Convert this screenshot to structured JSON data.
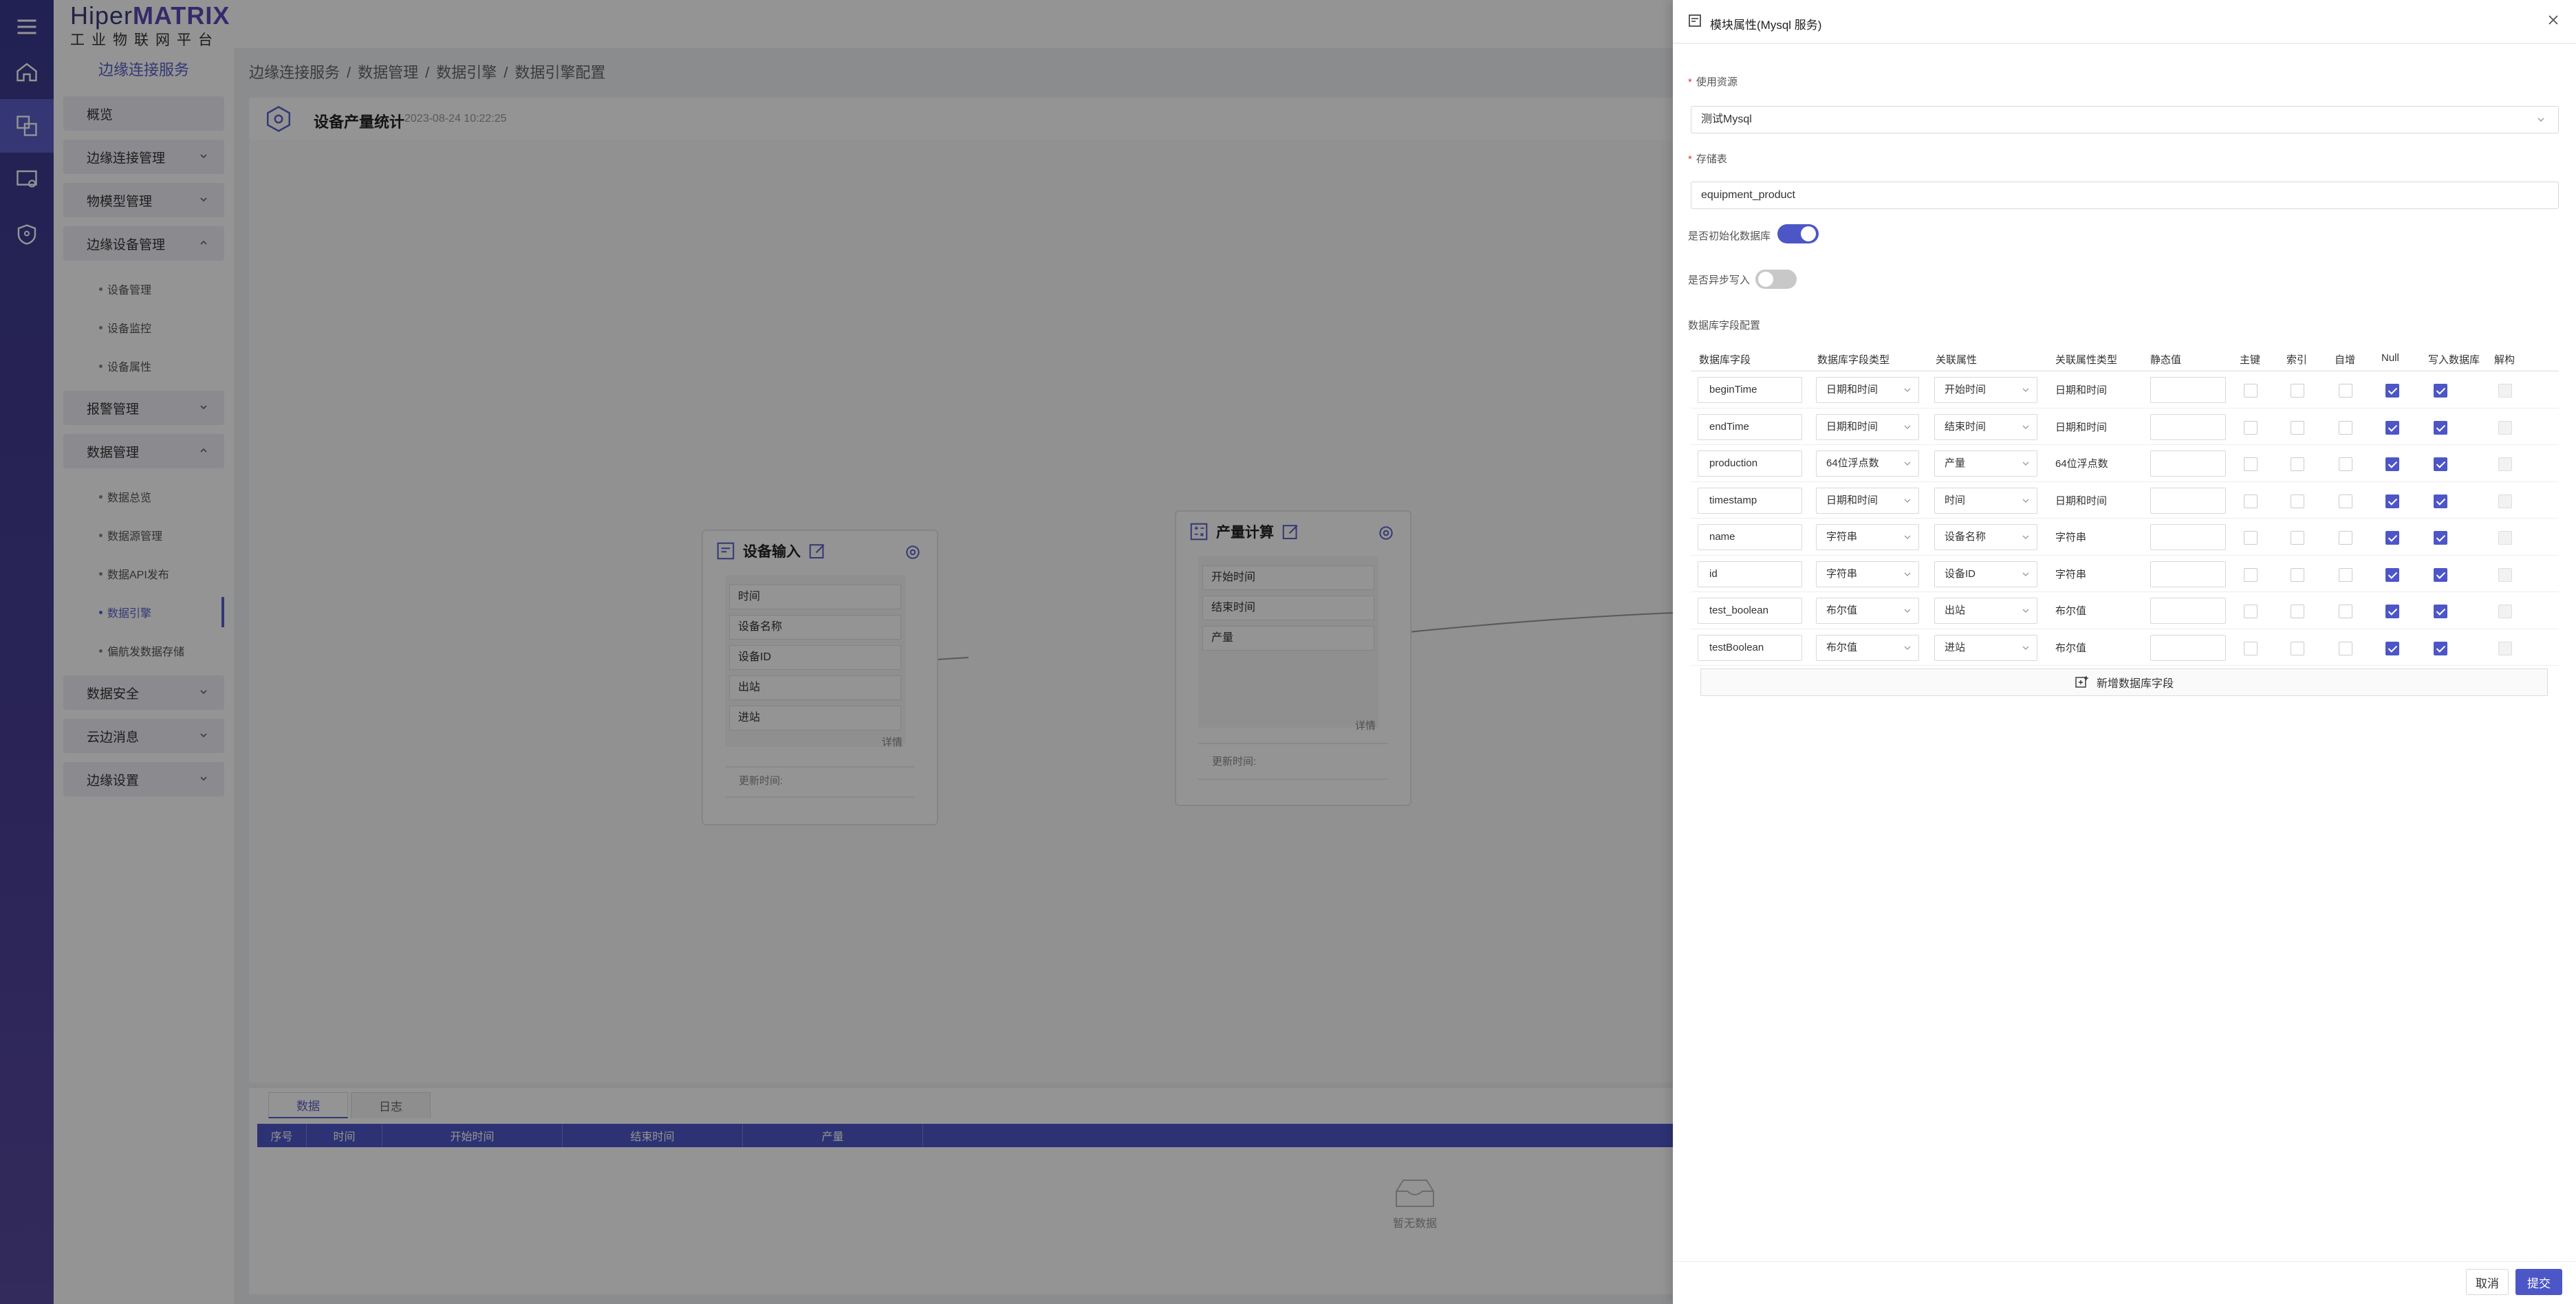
{
  "logo": {
    "brand_prefix": "Hiper",
    "brand_suffix": "MATRIX",
    "tagline": "工业物联网平台"
  },
  "sidebar": {
    "service_name": "边缘连接服务",
    "items": [
      {
        "label": "概览"
      },
      {
        "label": "边缘连接管理"
      },
      {
        "label": "物模型管理"
      },
      {
        "label": "边缘设备管理",
        "children": [
          "设备管理",
          "设备监控",
          "设备属性"
        ]
      },
      {
        "label": "报警管理"
      },
      {
        "label": "数据管理",
        "children": [
          "数据总览",
          "数据源管理",
          "数据API发布",
          "数据引擎",
          "偏航发数据存储"
        ]
      },
      {
        "label": "数据安全"
      },
      {
        "label": "云边消息"
      },
      {
        "label": "边缘设置"
      }
    ]
  },
  "breadcrumb": [
    "边缘连接服务",
    "/",
    "数据管理",
    "/",
    "数据引擎",
    "/",
    "数据引擎配置"
  ],
  "page": {
    "title": "设备产量统计",
    "date": "2023-08-24 10:22:25"
  },
  "nodes": {
    "input": {
      "title": "设备输入",
      "fields": [
        "时间",
        "设备名称",
        "设备ID",
        "出站",
        "进站"
      ],
      "detail": "详情",
      "updated": "更新时间:"
    },
    "calc": {
      "title": "产量计算",
      "fields": [
        "开始时间",
        "结束时间",
        "产量"
      ],
      "detail": "详情",
      "updated": "更新时间:"
    }
  },
  "bottom": {
    "tabs": [
      "数据",
      "日志"
    ],
    "columns": [
      "序号",
      "时间",
      "开始时间",
      "结束时间",
      "产量"
    ],
    "empty_text": "暂无数据"
  },
  "drawer": {
    "title": "模块属性(Mysql 服务)",
    "resource_label": "使用资源",
    "resource_value": "测试Mysql",
    "table_label": "存储表",
    "table_value": "equipment_product",
    "init_label": "是否初始化数据库",
    "init_on": true,
    "async_label": "是否异步写入",
    "async_on": false,
    "config_label": "数据库字段配置",
    "columns": [
      "数据库字段",
      "数据库字段类型",
      "关联属性",
      "关联属性类型",
      "静态值",
      "主键",
      "索引",
      "自增",
      "Null",
      "写入数据库",
      "解构"
    ],
    "rows": [
      {
        "field": "beginTime",
        "type": "日期和时间",
        "attr": "开始时间",
        "attr_type": "日期和时间",
        "null": true,
        "write": true
      },
      {
        "field": "endTime",
        "type": "日期和时间",
        "attr": "结束时间",
        "attr_type": "日期和时间",
        "null": true,
        "write": true
      },
      {
        "field": "production",
        "type": "64位浮点数",
        "attr": "产量",
        "attr_type": "64位浮点数",
        "null": true,
        "write": true
      },
      {
        "field": "timestamp",
        "type": "日期和时间",
        "attr": "时间",
        "attr_type": "日期和时间",
        "null": true,
        "write": true
      },
      {
        "field": "name",
        "type": "字符串",
        "attr": "设备名称",
        "attr_type": "字符串",
        "null": true,
        "write": true
      },
      {
        "field": "id",
        "type": "字符串",
        "attr": "设备ID",
        "attr_type": "字符串",
        "null": true,
        "write": true
      },
      {
        "field": "test_boolean",
        "type": "布尔值",
        "attr": "出站",
        "attr_type": "布尔值",
        "null": true,
        "write": true
      },
      {
        "field": "testBoolean",
        "type": "布尔值",
        "attr": "进站",
        "attr_type": "布尔值",
        "null": true,
        "write": true
      }
    ],
    "add_label": "新增数据库字段",
    "cancel_label": "取消",
    "submit_label": "提交"
  },
  "colors": {
    "accent": "#4d56c7",
    "rail": "#3b3a8f"
  }
}
